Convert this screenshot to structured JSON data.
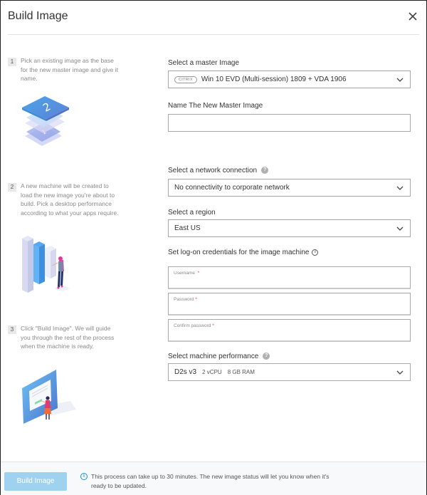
{
  "dialog": {
    "title": "Build Image",
    "close_icon": "close-icon"
  },
  "steps": [
    {
      "number": "1",
      "text": "Pick an existing image as the base for the new master image and give it name.",
      "illustration": "stacked-layers-illustration"
    },
    {
      "number": "2",
      "text": "A new machine will be created to load the new image you're about to build. Pick a desktop performance according to what your apps require.",
      "illustration": "machine-bars-illustration"
    },
    {
      "number": "3",
      "text": "Click \"Build Image\". We will guide you through the rest of the process when the machine is ready.",
      "illustration": "screen-person-illustration"
    }
  ],
  "form": {
    "master_image": {
      "label": "Select a master Image",
      "badge": "CITRIX",
      "value": "Win 10 EVD (Multi-session) 1809 + VDA 1906"
    },
    "new_name": {
      "label": "Name The New Master Image",
      "value": ""
    },
    "network": {
      "label": "Select a network connection",
      "help_icon": "?",
      "value": "No connectivity to corporate network"
    },
    "region": {
      "label": "Select a region",
      "value": "East US"
    },
    "credentials": {
      "label": "Set log-on credentials for the image machine",
      "info_icon": "i",
      "username_placeholder": "Username",
      "password_placeholder": "Password",
      "confirm_placeholder": "Confirm password",
      "required_mark": "*"
    },
    "performance": {
      "label": "Select machine performance",
      "help_icon": "?",
      "size": "D2s v3",
      "cpu": "2 vCPU",
      "ram": "8 GB RAM"
    }
  },
  "footer": {
    "build_button": "Build Image",
    "info_icon": "i",
    "info_text": "This process can take up to 30 minutes. The new image status will let you know when it's ready to be updated."
  },
  "colors": {
    "accent": "#1a8fd6",
    "button_disabled": "#9fd2ef",
    "required": "#e0443e"
  }
}
